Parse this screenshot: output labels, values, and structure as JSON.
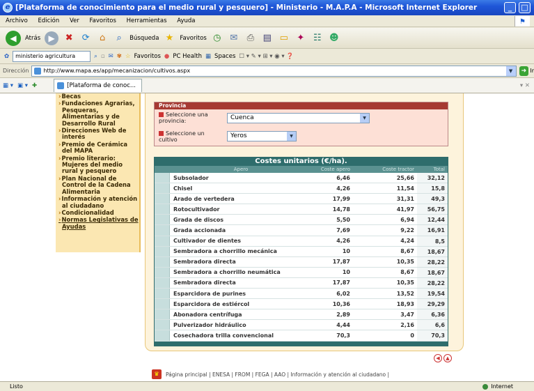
{
  "window": {
    "title": "[Plataforma de conocimiento para el medio rural y pesquero] - Ministerio - M.A.P.A - Microsoft Internet Explorer",
    "min": "_",
    "max": "□"
  },
  "menu": [
    "Archivo",
    "Edición",
    "Ver",
    "Favoritos",
    "Herramientas",
    "Ayuda"
  ],
  "toolbar": {
    "back": "Atrás",
    "search": "Búsqueda",
    "favorites": "Favoritos"
  },
  "links": {
    "search_value": "ministerio agricultura",
    "favorites": "Favoritos",
    "pchealth": "PC Health",
    "spaces": "Spaces"
  },
  "address": {
    "label": "Dirección",
    "url": "http://www.mapa.es/app/mecanizacion/cultivos.aspx",
    "go": "Ir"
  },
  "tab": {
    "label": "[Plataforma de conoc..."
  },
  "left_menu": [
    "Becas",
    "Fundaciones Agrarias, Pesqueras, Alimentarias y de Desarrollo Rural",
    "Direcciones Web de interés",
    "Premio de Cerámica del MAPA",
    "Premio literario: Mujeres del medio rural y pesquero",
    "Plan Nacional de Control de la Cadena Alimentaria",
    "Información y atención al ciudadano",
    "Condicionalidad",
    "Normas Legislativas de Ayudas"
  ],
  "form": {
    "heading": "Provincia",
    "province_label": "Seleccione una provincia:",
    "province_value": "Cuenca",
    "crop_label": "Seleccione un cultivo",
    "crop_value": "Yeros"
  },
  "table": {
    "caption": "Costes unitarios (€/ha).",
    "headers": [
      "Apero",
      "Coste apero",
      "Coste tractor",
      "Total"
    ],
    "rows": [
      [
        "Subsolador",
        "6,46",
        "25,66",
        "32,12"
      ],
      [
        "Chisel",
        "4,26",
        "11,54",
        "15,8"
      ],
      [
        "Arado de vertedera",
        "17,99",
        "31,31",
        "49,3"
      ],
      [
        "Rotocultivador",
        "14,78",
        "41,97",
        "56,75"
      ],
      [
        "Grada de discos",
        "5,50",
        "6,94",
        "12,44"
      ],
      [
        "Grada accionada",
        "7,69",
        "9,22",
        "16,91"
      ],
      [
        "Cultivador de dientes",
        "4,26",
        "4,24",
        "8,5"
      ],
      [
        "Sembradora a chorrillo mecánica",
        "10",
        "8,67",
        "18,67"
      ],
      [
        "Sembradora directa",
        "17,87",
        "10,35",
        "28,22"
      ],
      [
        "Sembradora a chorrillo neumática",
        "10",
        "8,67",
        "18,67"
      ],
      [
        "Sembradora directa",
        "17,87",
        "10,35",
        "28,22"
      ],
      [
        "Esparcidora de purines",
        "6,02",
        "13,52",
        "19,54"
      ],
      [
        "Esparcidora de estiércol",
        "10,36",
        "18,93",
        "29,29"
      ],
      [
        "Abonadora centrífuga",
        "2,89",
        "3,47",
        "6,36"
      ],
      [
        "Pulverizador hidráulico",
        "4,44",
        "2,16",
        "6,6"
      ],
      [
        "Cosechadora trilla convencional",
        "70,3",
        "0",
        "70,3"
      ]
    ]
  },
  "footer": "Página principal | ENESA | FROM | FEGA | AAO | Información y atención al ciudadano |",
  "status": {
    "left": "Listo",
    "zone": "Internet"
  },
  "colors": {
    "title_bar": "#1f56d8",
    "table_header": "#2e6d6c",
    "menu_bg": "#fbe7b2"
  }
}
